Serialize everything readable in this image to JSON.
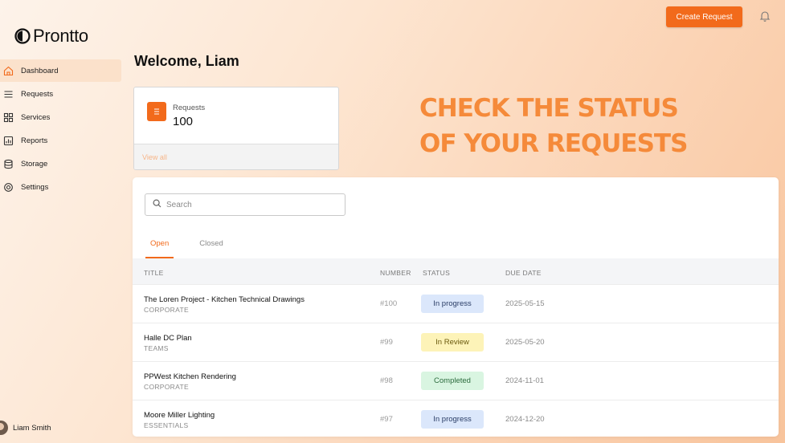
{
  "header": {
    "create_button": "Create Request",
    "bell_icon": "bell-icon"
  },
  "brand": {
    "name": "Prontto",
    "accent_color": "#f26a1b"
  },
  "sidebar": {
    "items": [
      {
        "label": "Dashboard",
        "icon": "home-icon",
        "active": true
      },
      {
        "label": "Requests",
        "icon": "list-icon",
        "active": false
      },
      {
        "label": "Services",
        "icon": "grid-icon",
        "active": false
      },
      {
        "label": "Reports",
        "icon": "report-icon",
        "active": false
      },
      {
        "label": "Storage",
        "icon": "database-icon",
        "active": false
      },
      {
        "label": "Settings",
        "icon": "gear-icon",
        "active": false
      }
    ],
    "user": {
      "name": "Liam Smith"
    }
  },
  "main": {
    "welcome": "Welcome, Liam",
    "stat_card": {
      "label": "Requests",
      "value": "100",
      "link": "View all"
    },
    "headline_line1": "CHECK THE STATUS",
    "headline_line2": "OF YOUR REQUESTS",
    "search": {
      "placeholder": "Search"
    },
    "tabs": [
      {
        "label": "Open",
        "active": true
      },
      {
        "label": "Closed",
        "active": false
      }
    ],
    "table": {
      "columns": [
        "TITLE",
        "NUMBER",
        "STATUS",
        "DUE DATE"
      ],
      "rows": [
        {
          "title": "The Loren Project - Kitchen Technical Drawings",
          "category": "CORPORATE",
          "number": "#100",
          "status": "In progress",
          "due": "2025-05-15"
        },
        {
          "title": "Halle DC Plan",
          "category": "TEAMS",
          "number": "#99",
          "status": "In Review",
          "due": "2025-05-20"
        },
        {
          "title": "PPWest Kitchen Rendering",
          "category": "CORPORATE",
          "number": "#98",
          "status": "Completed",
          "due": "2024-11-01"
        },
        {
          "title": "Moore Miller Lighting",
          "category": "ESSENTIALS",
          "number": "#97",
          "status": "In progress",
          "due": "2024-12-20"
        }
      ]
    },
    "status_colors": {
      "In progress": {
        "bg": "#dbe7fb",
        "fg": "#2a3d66"
      },
      "In Review": {
        "bg": "#fdf3b8",
        "fg": "#6b5a0e"
      },
      "Completed": {
        "bg": "#d9f5e1",
        "fg": "#2c6b3d"
      }
    }
  }
}
